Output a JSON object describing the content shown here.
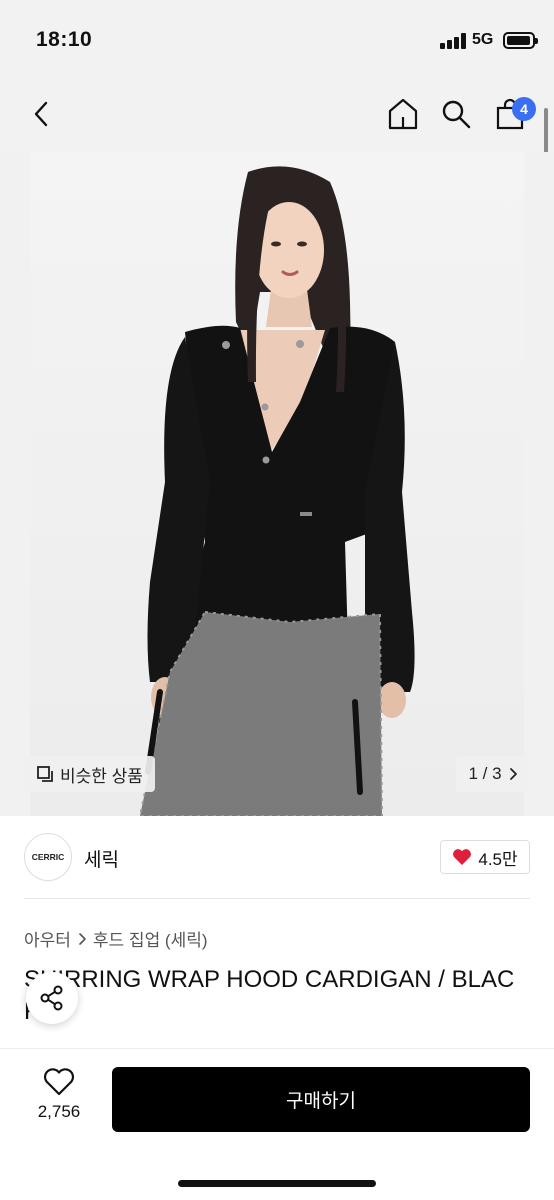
{
  "status_bar": {
    "time": "18:10",
    "network": "5G"
  },
  "header": {
    "cart_count": "4"
  },
  "image": {
    "similar_label": "비슷한 상품",
    "pager": "1 / 3"
  },
  "brand": {
    "logo_text": "CERRIC",
    "name": "세릭",
    "likes": "4.5만"
  },
  "breadcrumb": {
    "category": "아우터",
    "subcategory": "후드 집업 (세릭)"
  },
  "product": {
    "title": "SHIRRING WRAP HOOD CARDIGAN / BLACK"
  },
  "bottom": {
    "wish_count": "2,756",
    "buy_label": "구매하기"
  },
  "colors": {
    "badge": "#3b6ff2",
    "heart": "#e0203a",
    "buy_button": "#000000"
  }
}
